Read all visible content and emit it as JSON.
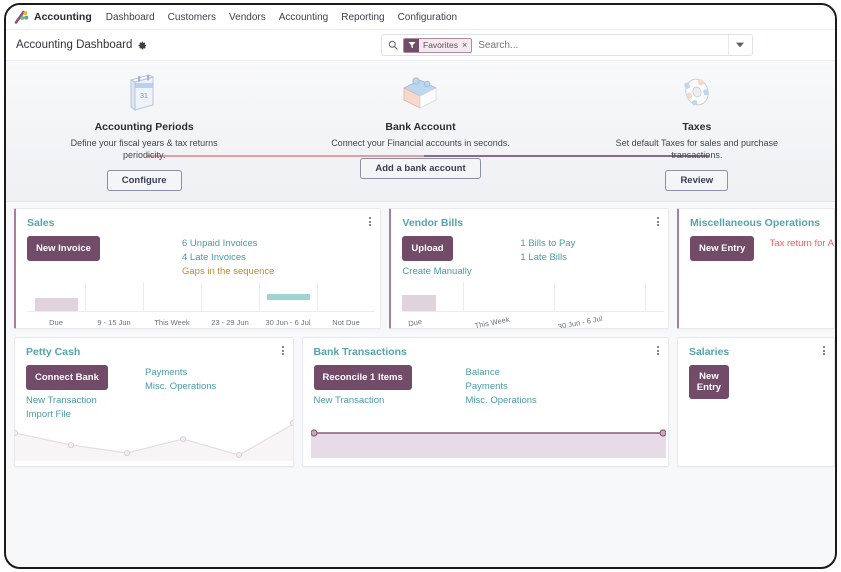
{
  "navbar": {
    "brand": "Accounting",
    "logo_icon": "odoo-logo-icon",
    "items": [
      {
        "label": "Dashboard"
      },
      {
        "label": "Customers"
      },
      {
        "label": "Vendors"
      },
      {
        "label": "Accounting"
      },
      {
        "label": "Reporting"
      },
      {
        "label": "Configuration"
      }
    ]
  },
  "control_panel": {
    "title": "Accounting Dashboard",
    "gear_icon": "gear-icon",
    "search": {
      "search_icon": "search-icon",
      "facet_icon": "filter-icon",
      "facet_label": "Favorites",
      "facet_remove": "×",
      "placeholder": "Search...",
      "toggle_icon": "chevron-down-icon"
    }
  },
  "onboarding": {
    "steps": [
      {
        "icon": "calendar-icon",
        "title": "Accounting Periods",
        "description": "Define your fiscal years & tax returns periodicity.",
        "button": "Configure"
      },
      {
        "icon": "bank-puzzle-icon",
        "title": "Bank Account",
        "description": "Connect your Financial accounts in seconds.",
        "button": "Add a bank account"
      },
      {
        "icon": "taxes-gear-icon",
        "title": "Taxes",
        "description": "Set default Taxes for sales and purchase transactions.",
        "button": "Review"
      }
    ]
  },
  "cards": {
    "sales": {
      "title": "Sales",
      "kebab_icon": "kebab-menu-icon",
      "primary_button": "New Invoice",
      "links": [
        {
          "label": "6 Unpaid Invoices",
          "style": "normal"
        },
        {
          "label": "4 Late Invoices",
          "style": "normal"
        },
        {
          "label": "Gaps in the sequence",
          "style": "warn"
        }
      ]
    },
    "vendor_bills": {
      "title": "Vendor Bills",
      "kebab_icon": "kebab-menu-icon",
      "primary_button": "Upload",
      "secondary_link": "Create Manually",
      "links": [
        {
          "label": "1 Bills to Pay",
          "style": "normal"
        },
        {
          "label": "1 Late Bills",
          "style": "normal"
        }
      ]
    },
    "misc_operations": {
      "title": "Miscellaneous Operations",
      "primary_button": "New Entry",
      "links": [
        {
          "label": "Tax return for A",
          "style": "danger"
        }
      ]
    },
    "petty_cash": {
      "title": "Petty Cash",
      "kebab_icon": "kebab-menu-icon",
      "primary_button": "Connect Bank",
      "left_links": [
        {
          "label": "New Transaction",
          "style": "normal"
        },
        {
          "label": "Import File",
          "style": "normal"
        }
      ],
      "right_links": [
        {
          "label": "Payments",
          "style": "normal"
        },
        {
          "label": "Misc. Operations",
          "style": "normal"
        }
      ]
    },
    "bank_transactions": {
      "title": "Bank Transactions",
      "kebab_icon": "kebab-menu-icon",
      "primary_button": "Reconcile 1 Items",
      "left_links": [
        {
          "label": "New Transaction",
          "style": "normal"
        }
      ],
      "right_links": [
        {
          "label": "Balance",
          "style": "normal"
        },
        {
          "label": "Payments",
          "style": "normal"
        },
        {
          "label": "Misc. Operations",
          "style": "normal"
        }
      ]
    },
    "salaries": {
      "title": "Salaries",
      "kebab_icon": "kebab-menu-icon",
      "primary_button": "New Entry"
    }
  },
  "chart_data": [
    {
      "id": "sales_chart",
      "type": "bar",
      "title": "Sales",
      "categories": [
        "Due",
        "9 - 15 Jun",
        "This Week",
        "23 - 29 Jun",
        "30 Jun - 6 Jul",
        "Not Due"
      ],
      "values": [
        -1,
        0,
        0,
        0,
        1,
        0
      ],
      "colors": [
        "#e0d3dd",
        null,
        null,
        null,
        "#9fd4d2",
        null
      ],
      "xlabel": "",
      "ylabel": "",
      "grid": true,
      "legend": "none"
    },
    {
      "id": "vendor_bills_chart",
      "type": "bar",
      "title": "Vendor Bills",
      "categories": [
        "Due",
        "This Week",
        "30 Jun - 6 Jul",
        ""
      ],
      "values": [
        -1,
        0,
        0,
        0
      ],
      "colors": [
        "#e0d3dd",
        null,
        null,
        null
      ],
      "xlabel": "",
      "ylabel": "",
      "grid": true,
      "legend": "none"
    },
    {
      "id": "petty_cash_chart",
      "type": "area",
      "title": "Petty Cash",
      "x": [
        0,
        1,
        2,
        3,
        4,
        5
      ],
      "values": [
        0.38,
        0.18,
        0.05,
        0.3,
        0.02,
        0.72
      ],
      "line_color": "#e6dce3",
      "fill_color": "#f7f4f6",
      "grid": false,
      "legend": "none"
    },
    {
      "id": "bank_transactions_chart",
      "type": "area",
      "title": "Bank Transactions",
      "x": [
        0,
        1
      ],
      "values": [
        1.0,
        1.0
      ],
      "line_color": "#8b5a7c",
      "fill_color": "#e6dce6",
      "grid": false,
      "legend": "none"
    }
  ]
}
